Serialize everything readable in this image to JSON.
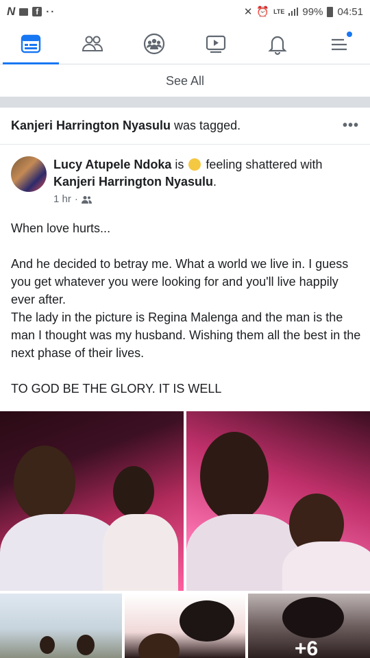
{
  "status_bar": {
    "left_icons": [
      "n-app-icon",
      "message-icon",
      "facebook-icon",
      "more-dots-icon"
    ],
    "network": "LTE",
    "battery": "99%",
    "time": "04:51"
  },
  "tabs": [
    {
      "name": "news-feed",
      "icon": "news-feed-icon",
      "active": true
    },
    {
      "name": "friends",
      "icon": "friends-icon",
      "active": false
    },
    {
      "name": "groups",
      "icon": "groups-icon",
      "active": false
    },
    {
      "name": "watch",
      "icon": "video-icon",
      "active": false
    },
    {
      "name": "notifications",
      "icon": "bell-icon",
      "active": false
    },
    {
      "name": "menu",
      "icon": "menu-icon",
      "active": false,
      "badge": true
    }
  ],
  "see_all": "See All",
  "story": {
    "tagged_name": "Kanjeri Harrington Nyasulu",
    "tagged_suffix": " was tagged.",
    "more": "•••"
  },
  "post": {
    "author": "Lucy Atupele Ndoka",
    "feeling_prefix": " is ",
    "feeling_text": " feeling shattered with",
    "with_name": "Kanjeri Harrington Nyasulu",
    "with_suffix": ".",
    "time": "1 hr",
    "privacy_icon": "friends-privacy-icon",
    "paragraphs": [
      "When love hurts...",
      "And he decided to betray me. What a world we live in. I guess you get whatever you were looking for and you'll live happily ever after.\nThe lady in the picture is Regina Malenga and the man is the man I thought was my husband. Wishing them all the best in the next phase of their lives.",
      "TO GOD BE THE GLORY. IT IS WELL"
    ],
    "more_photos": "+6"
  },
  "colors": {
    "accent": "#1877f2",
    "divider": "#dadde1",
    "text": "#1c1e21",
    "muted": "#606770"
  }
}
